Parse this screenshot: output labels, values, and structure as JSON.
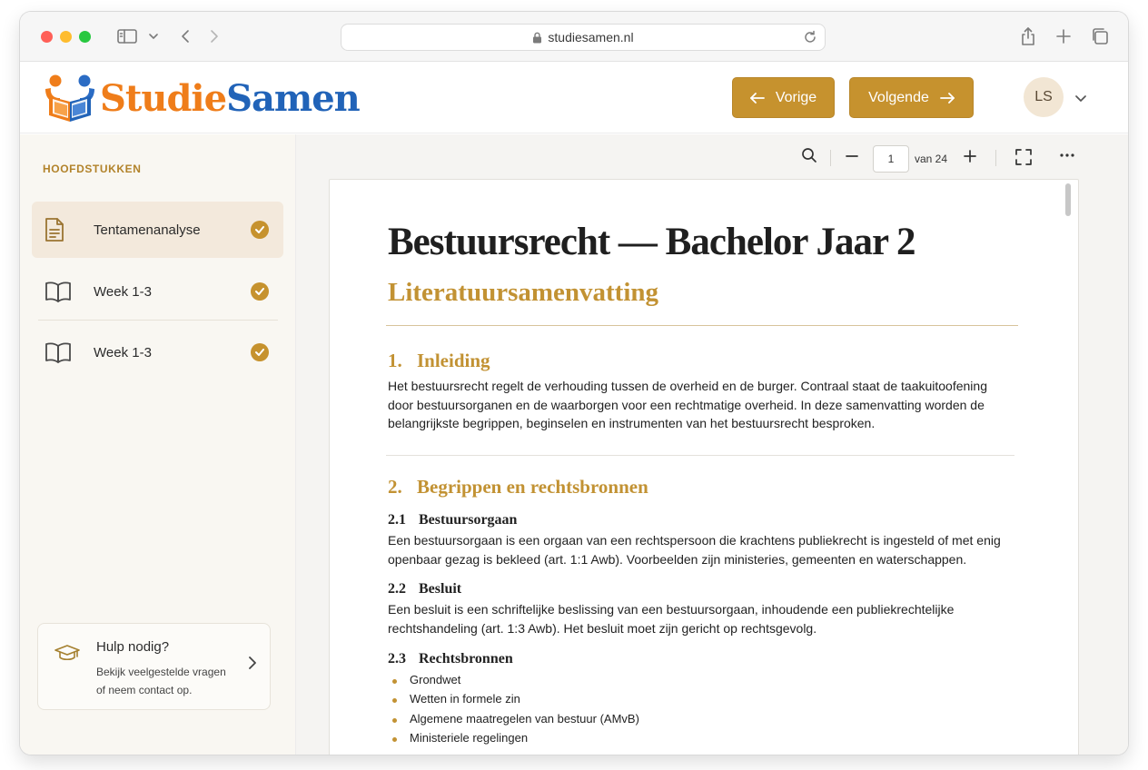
{
  "browser": {
    "url": "studiesamen.nl"
  },
  "site": {
    "logo_part1": "Studie",
    "logo_part2": "Samen",
    "prev_label": "Vorige",
    "next_label": "Volgende",
    "avatar_initials": "LS",
    "colors": {
      "accent": "#c6922e",
      "logo_orange": "#ef7d1a",
      "logo_blue": "#2163b8"
    }
  },
  "sidebar": {
    "heading": "HOOFDSTUKKEN",
    "items": [
      {
        "label": "Tentamenanalyse",
        "icon": "document-icon",
        "completed": true,
        "active": true
      },
      {
        "label": "Week 1-3",
        "icon": "book-icon",
        "completed": true,
        "active": false
      },
      {
        "label": "Week 1-3",
        "icon": "book-icon",
        "completed": true,
        "active": false
      }
    ],
    "help": {
      "title": "Hulp nodig?",
      "text_line1": "Bekijk veelgestelde vragen",
      "text_line2": "of neem contact op."
    }
  },
  "viewer": {
    "page": "1",
    "page_of": "van 24"
  },
  "document": {
    "title": "Bestuursrecht — Bachelor Jaar 2",
    "subtitle": "Literatuursamenvatting",
    "s1": {
      "num": "1.",
      "title": "Inleiding",
      "lines": [
        "Het bestuursrecht regelt de verhouding tussen de overheid en de burger. Contraal staat de taakuitoofening",
        "door bestuursorganen en de waarborgen voor een rechtmatige overheid. In deze samenvatting worden de",
        "belangrijkste begrippen, beginselen en instrumenten van het bestuursrecht besproken."
      ]
    },
    "s2": {
      "num": "2.",
      "title": "Begrippen en rechtsbronnen",
      "sub1": {
        "num": "2.1",
        "title": "Bestuursorgaan",
        "lines": [
          "Een bestuursorgaan is een orgaan van een rechtspersoon die krachtens publiekrecht is ingesteld of met enig",
          "openbaar gezag is bekleed (art. 1:1 Awb). Voorbeelden zijn ministeries, gemeenten en waterschappen."
        ]
      },
      "sub2": {
        "num": "2.2",
        "title": "Besluit",
        "lines": [
          "Een besluit is een schriftelijke beslissing van een bestuursorgaan, inhoudende een publiekrechtelijke",
          "rechtshandeling (art. 1:3 Awb). Het besluit moet zijn gericht op rechtsgevolg."
        ]
      },
      "sub3": {
        "num": "2.3",
        "title": "Rechtsbronnen",
        "bullets": [
          "Grondwet",
          "Wetten in formele zin",
          "Algemene maatregelen van bestuur (AMvB)",
          "Ministeriele regelingen"
        ]
      }
    }
  }
}
